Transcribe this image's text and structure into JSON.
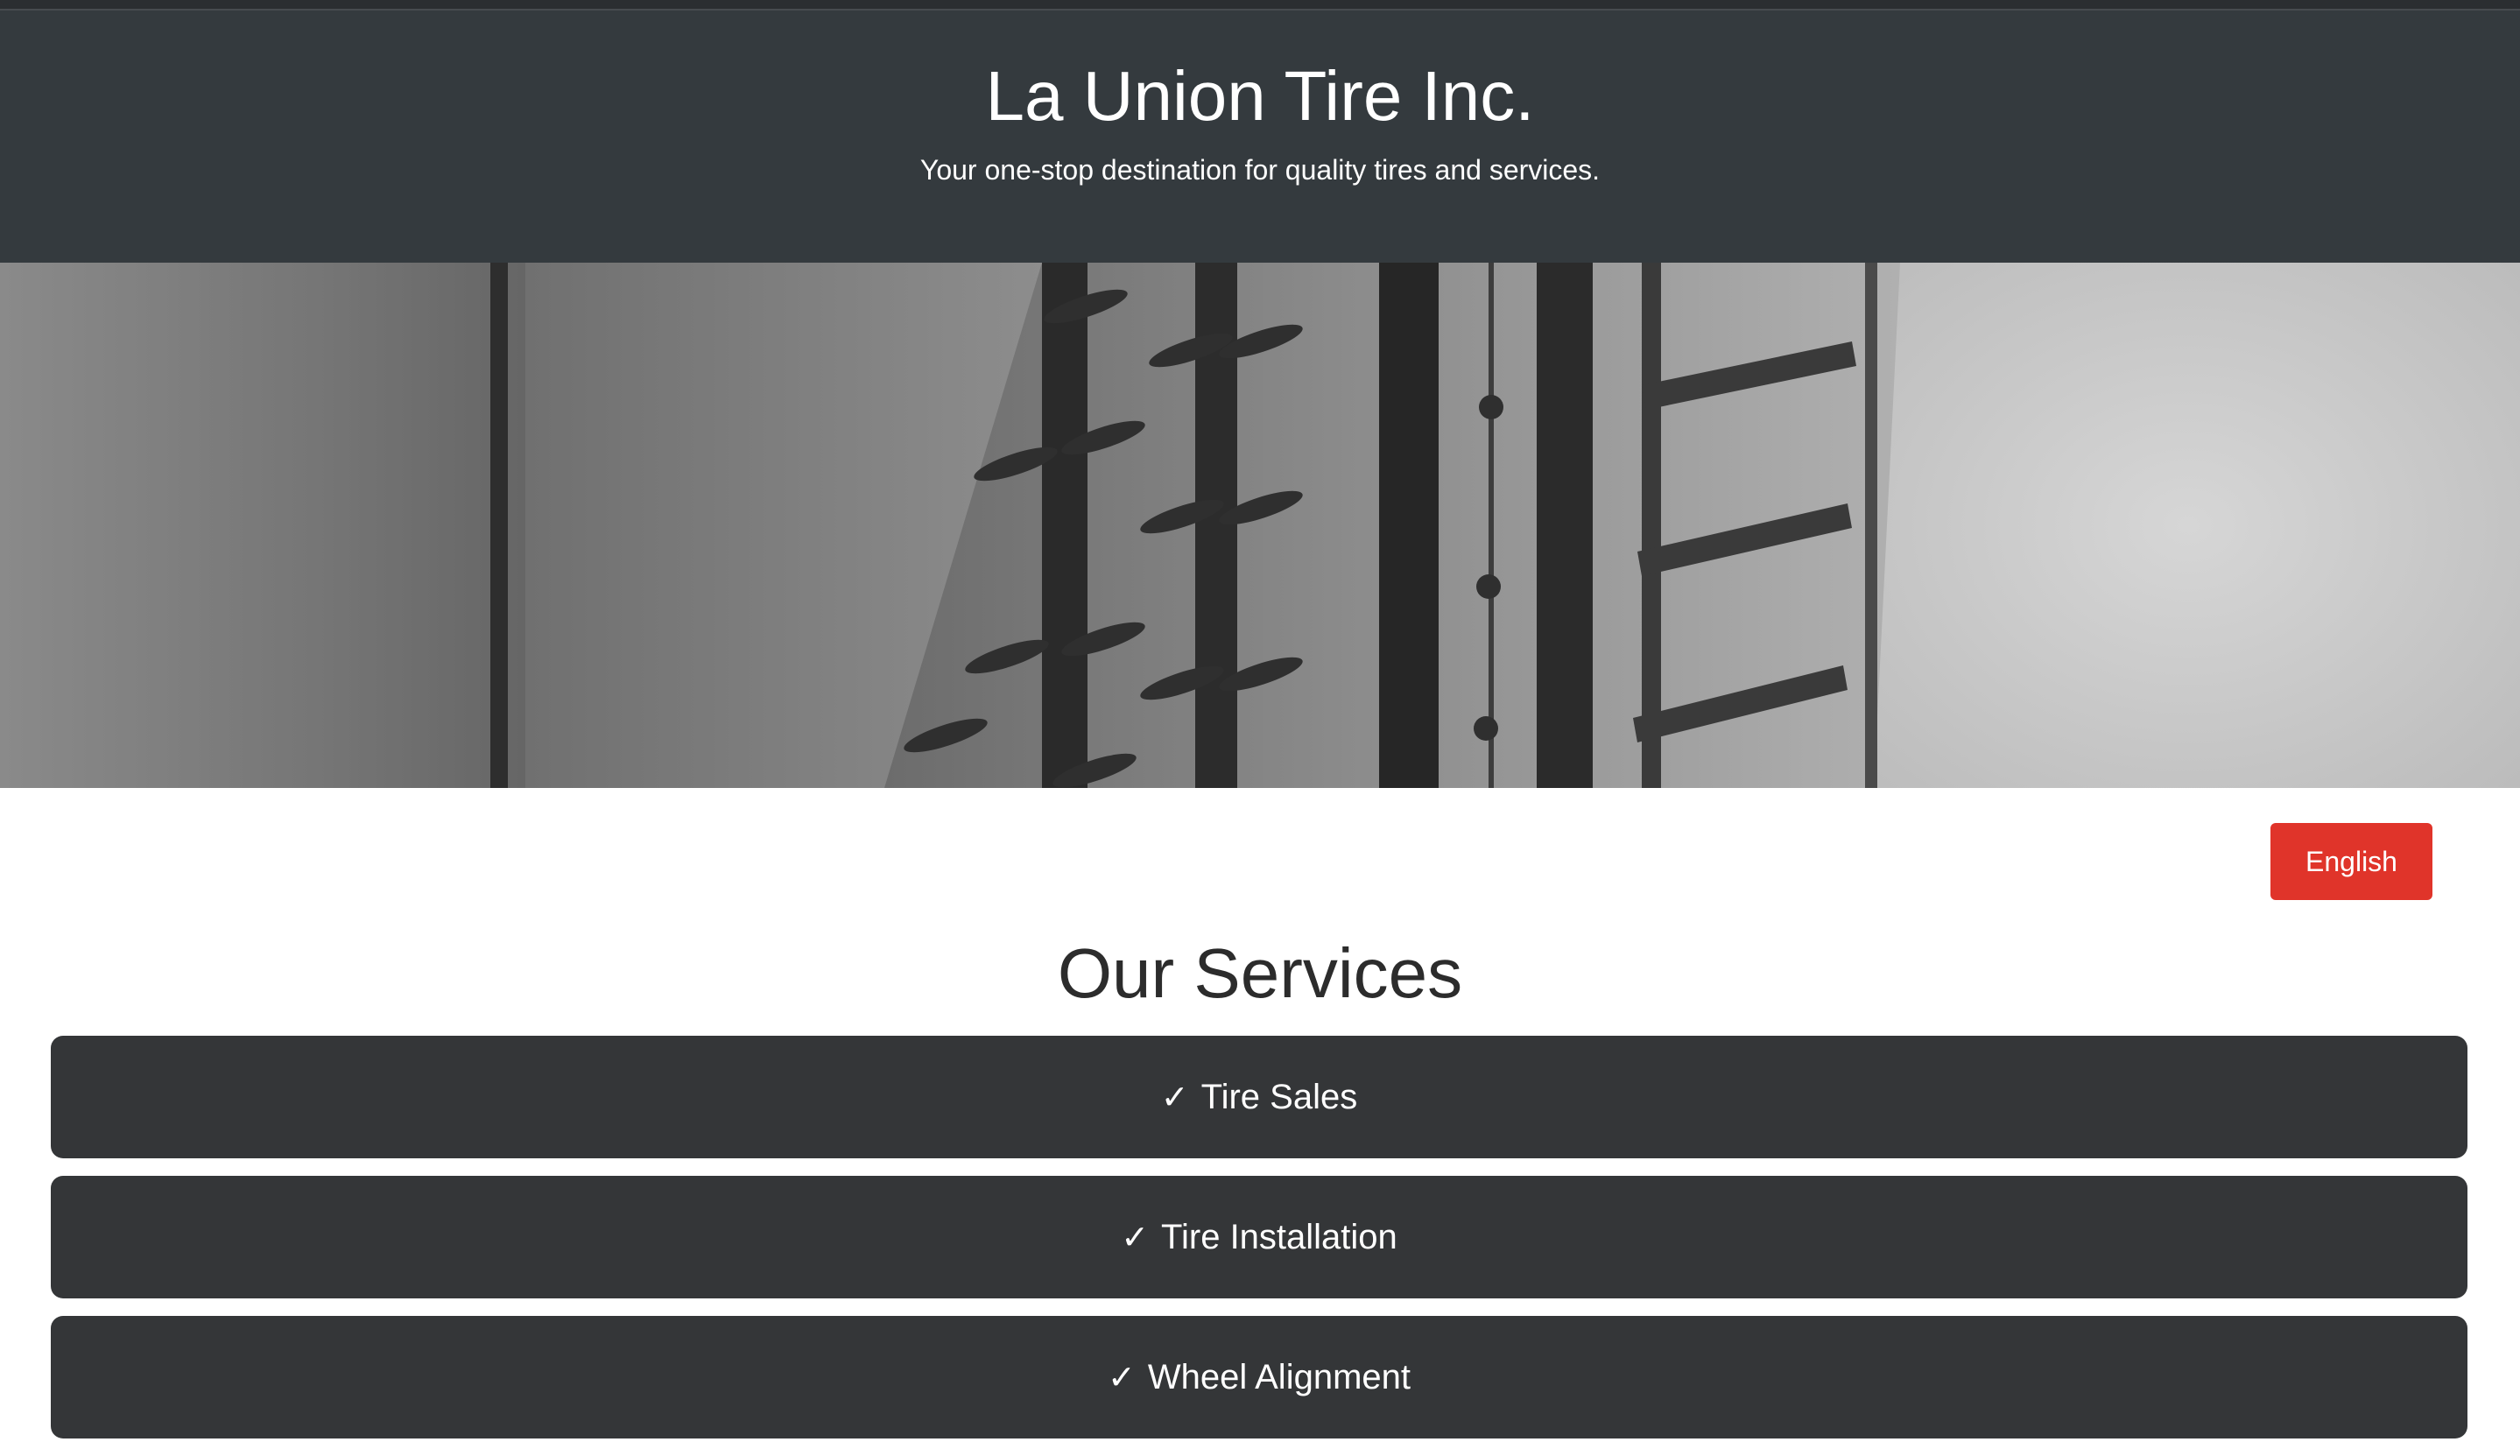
{
  "header": {
    "title": "La Union Tire Inc.",
    "subtitle": "Your one-stop destination for quality tires and services."
  },
  "hero": {
    "image": "tire-tread-photo",
    "tone": "grayscale"
  },
  "language_button": {
    "label": "English",
    "color": "#e0342a"
  },
  "services": {
    "heading": "Our Services",
    "check_glyph": "✓",
    "items": [
      {
        "label": "Tire Sales"
      },
      {
        "label": "Tire Installation"
      },
      {
        "label": "Wheel Alignment"
      }
    ]
  },
  "colors": {
    "header_bg": "#343a3e",
    "service_bg": "#343638",
    "accent": "#e0342a"
  }
}
